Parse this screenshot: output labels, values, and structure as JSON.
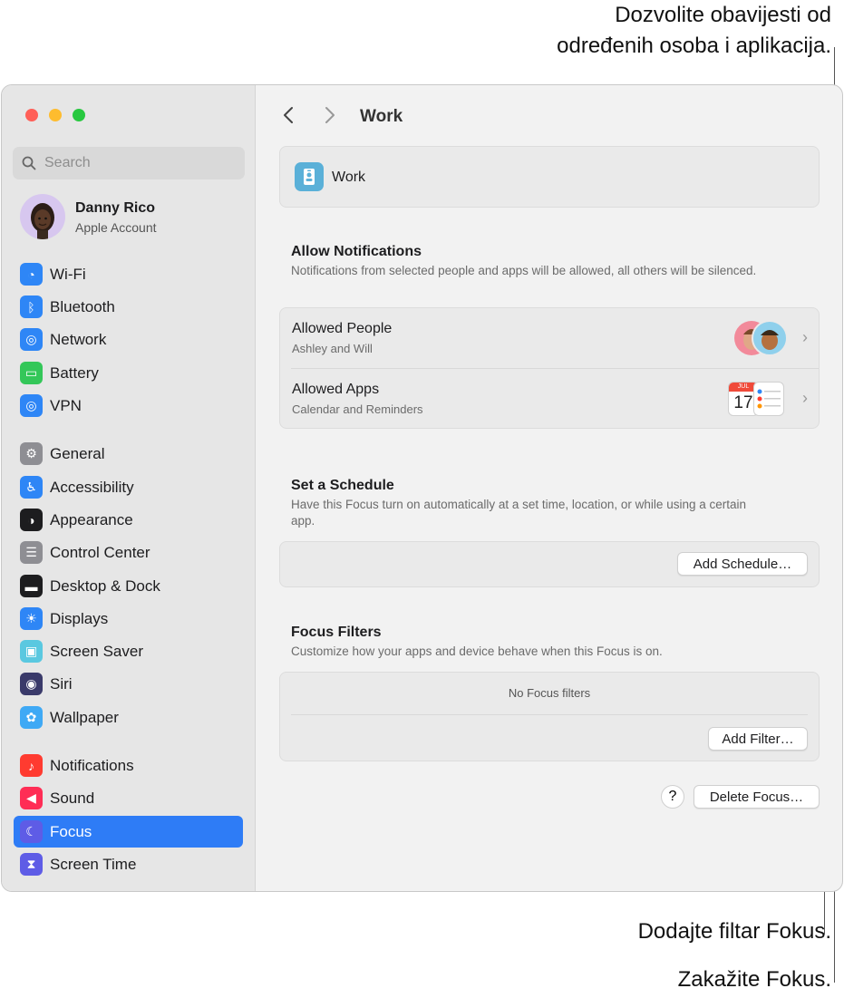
{
  "callouts": {
    "allow_line1": "Dozvolite obavijesti od",
    "allow_line2": "određenih osoba i aplikacija.",
    "filter": "Dodajte filtar Fokus.",
    "schedule": "Zakažite Fokus."
  },
  "window_controls": {
    "close_color": "#ff5f57",
    "minimize_color": "#febc2e",
    "zoom_color": "#28c840"
  },
  "search": {
    "placeholder": "Search"
  },
  "account": {
    "name": "Danny Rico",
    "subtitle": "Apple Account"
  },
  "sidebar": {
    "groups": [
      [
        {
          "label": "Wi-Fi",
          "icon": "wifi-icon",
          "color": "#2e86f6"
        },
        {
          "label": "Bluetooth",
          "icon": "bluetooth-icon",
          "color": "#2e86f6"
        },
        {
          "label": "Network",
          "icon": "globe-icon",
          "color": "#2e86f6"
        },
        {
          "label": "Battery",
          "icon": "battery-icon",
          "color": "#34c759"
        },
        {
          "label": "VPN",
          "icon": "vpn-globe-icon",
          "color": "#2e86f6"
        }
      ],
      [
        {
          "label": "General",
          "icon": "gear-icon",
          "color": "#8e8e93"
        },
        {
          "label": "Accessibility",
          "icon": "accessibility-icon",
          "color": "#2e86f6"
        },
        {
          "label": "Appearance",
          "icon": "appearance-icon",
          "color": "#1d1d1f"
        },
        {
          "label": "Control Center",
          "icon": "control-center-icon",
          "color": "#8e8e93"
        },
        {
          "label": "Desktop & Dock",
          "icon": "dock-icon",
          "color": "#1d1d1f"
        },
        {
          "label": "Displays",
          "icon": "sun-icon",
          "color": "#2e86f6"
        },
        {
          "label": "Screen Saver",
          "icon": "screen-saver-icon",
          "color": "#5ac8e0"
        },
        {
          "label": "Siri",
          "icon": "siri-icon",
          "color": "#3a3a6a"
        },
        {
          "label": "Wallpaper",
          "icon": "flower-icon",
          "color": "#3fa9f5"
        }
      ],
      [
        {
          "label": "Notifications",
          "icon": "bell-icon",
          "color": "#ff3b30"
        },
        {
          "label": "Sound",
          "icon": "speaker-icon",
          "color": "#ff2d55"
        },
        {
          "label": "Focus",
          "icon": "moon-icon",
          "color": "#5e5ce6",
          "selected": true
        },
        {
          "label": "Screen Time",
          "icon": "hourglass-icon",
          "color": "#5e5ce6"
        }
      ]
    ]
  },
  "header": {
    "title": "Work"
  },
  "focus": {
    "name": "Work"
  },
  "allow": {
    "title": "Allow Notifications",
    "description": "Notifications from selected people and apps will be allowed, all others will be silenced.",
    "people": {
      "title": "Allowed People",
      "subtitle": "Ashley and Will"
    },
    "apps": {
      "title": "Allowed Apps",
      "subtitle": "Calendar and Reminders",
      "calendar_month": "JUL",
      "calendar_day": "17"
    }
  },
  "schedule": {
    "title": "Set a Schedule",
    "description": "Have this Focus turn on automatically at a set time, location, or while using a certain app.",
    "button": "Add Schedule…"
  },
  "filters": {
    "title": "Focus Filters",
    "description": "Customize how your apps and device behave when this Focus is on.",
    "empty": "No Focus filters",
    "button": "Add Filter…"
  },
  "footer": {
    "help": "?",
    "delete": "Delete Focus…"
  }
}
